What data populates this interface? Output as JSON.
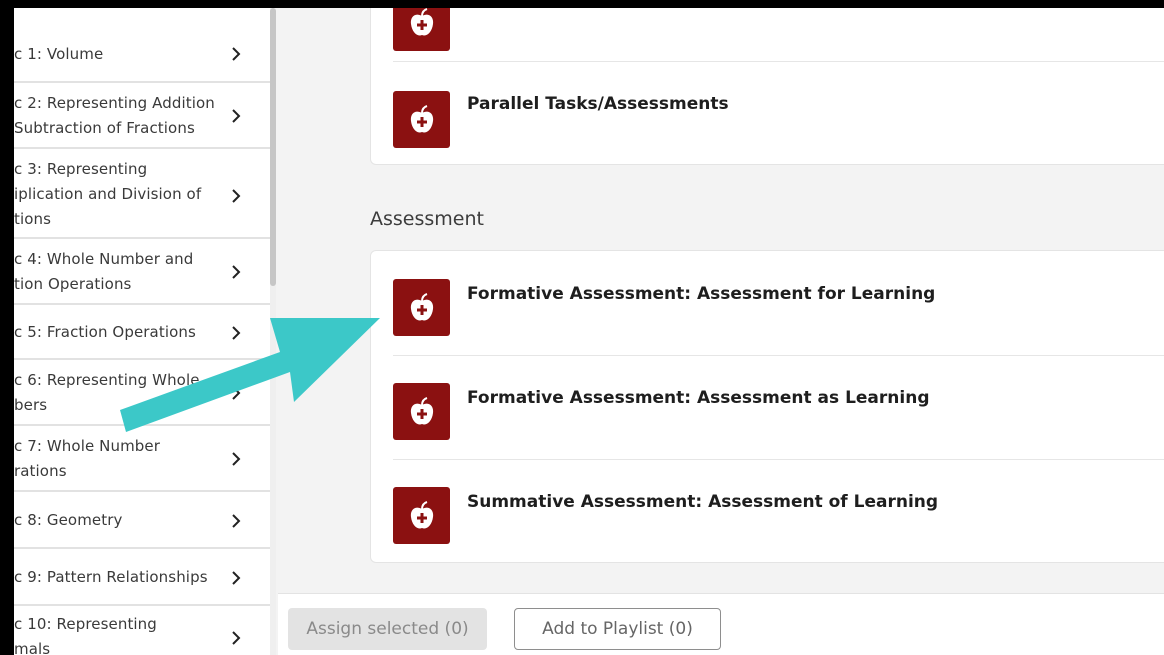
{
  "sidebar": {
    "items": [
      {
        "label": "c 1: Volume"
      },
      {
        "label": "c 2: Representing Addition\n Subtraction of Fractions"
      },
      {
        "label": "c 3: Representing\niplication and Division of\ntions"
      },
      {
        "label": "c 4: Whole Number and\ntion Operations"
      },
      {
        "label": "c 5: Fraction Operations"
      },
      {
        "label": "c 6: Representing Whole\nbers"
      },
      {
        "label": "c 7: Whole Number\nrations"
      },
      {
        "label": "c 8: Geometry"
      },
      {
        "label": "c 9: Pattern Relationships"
      },
      {
        "label": "c 10: Representing\nmals"
      }
    ]
  },
  "main": {
    "top_card": {
      "items": [
        {
          "title": ""
        },
        {
          "title": "Parallel Tasks/Assessments"
        }
      ]
    },
    "assessment_section": {
      "heading": "Assessment",
      "items": [
        {
          "title": "Formative Assessment: Assessment for Learning"
        },
        {
          "title": "Formative Assessment: Assessment as Learning"
        },
        {
          "title": "Summative Assessment: Assessment of Learning"
        }
      ]
    }
  },
  "footer": {
    "assign_label": "Assign selected (0)",
    "playlist_label": "Add to Playlist (0)"
  },
  "colors": {
    "resource_icon_bg": "#8b1111",
    "annotation_arrow": "#3cc8c8"
  },
  "icons": {
    "resource": "apple-plus-icon",
    "sidebar_chevron": "chevron-right-icon"
  }
}
